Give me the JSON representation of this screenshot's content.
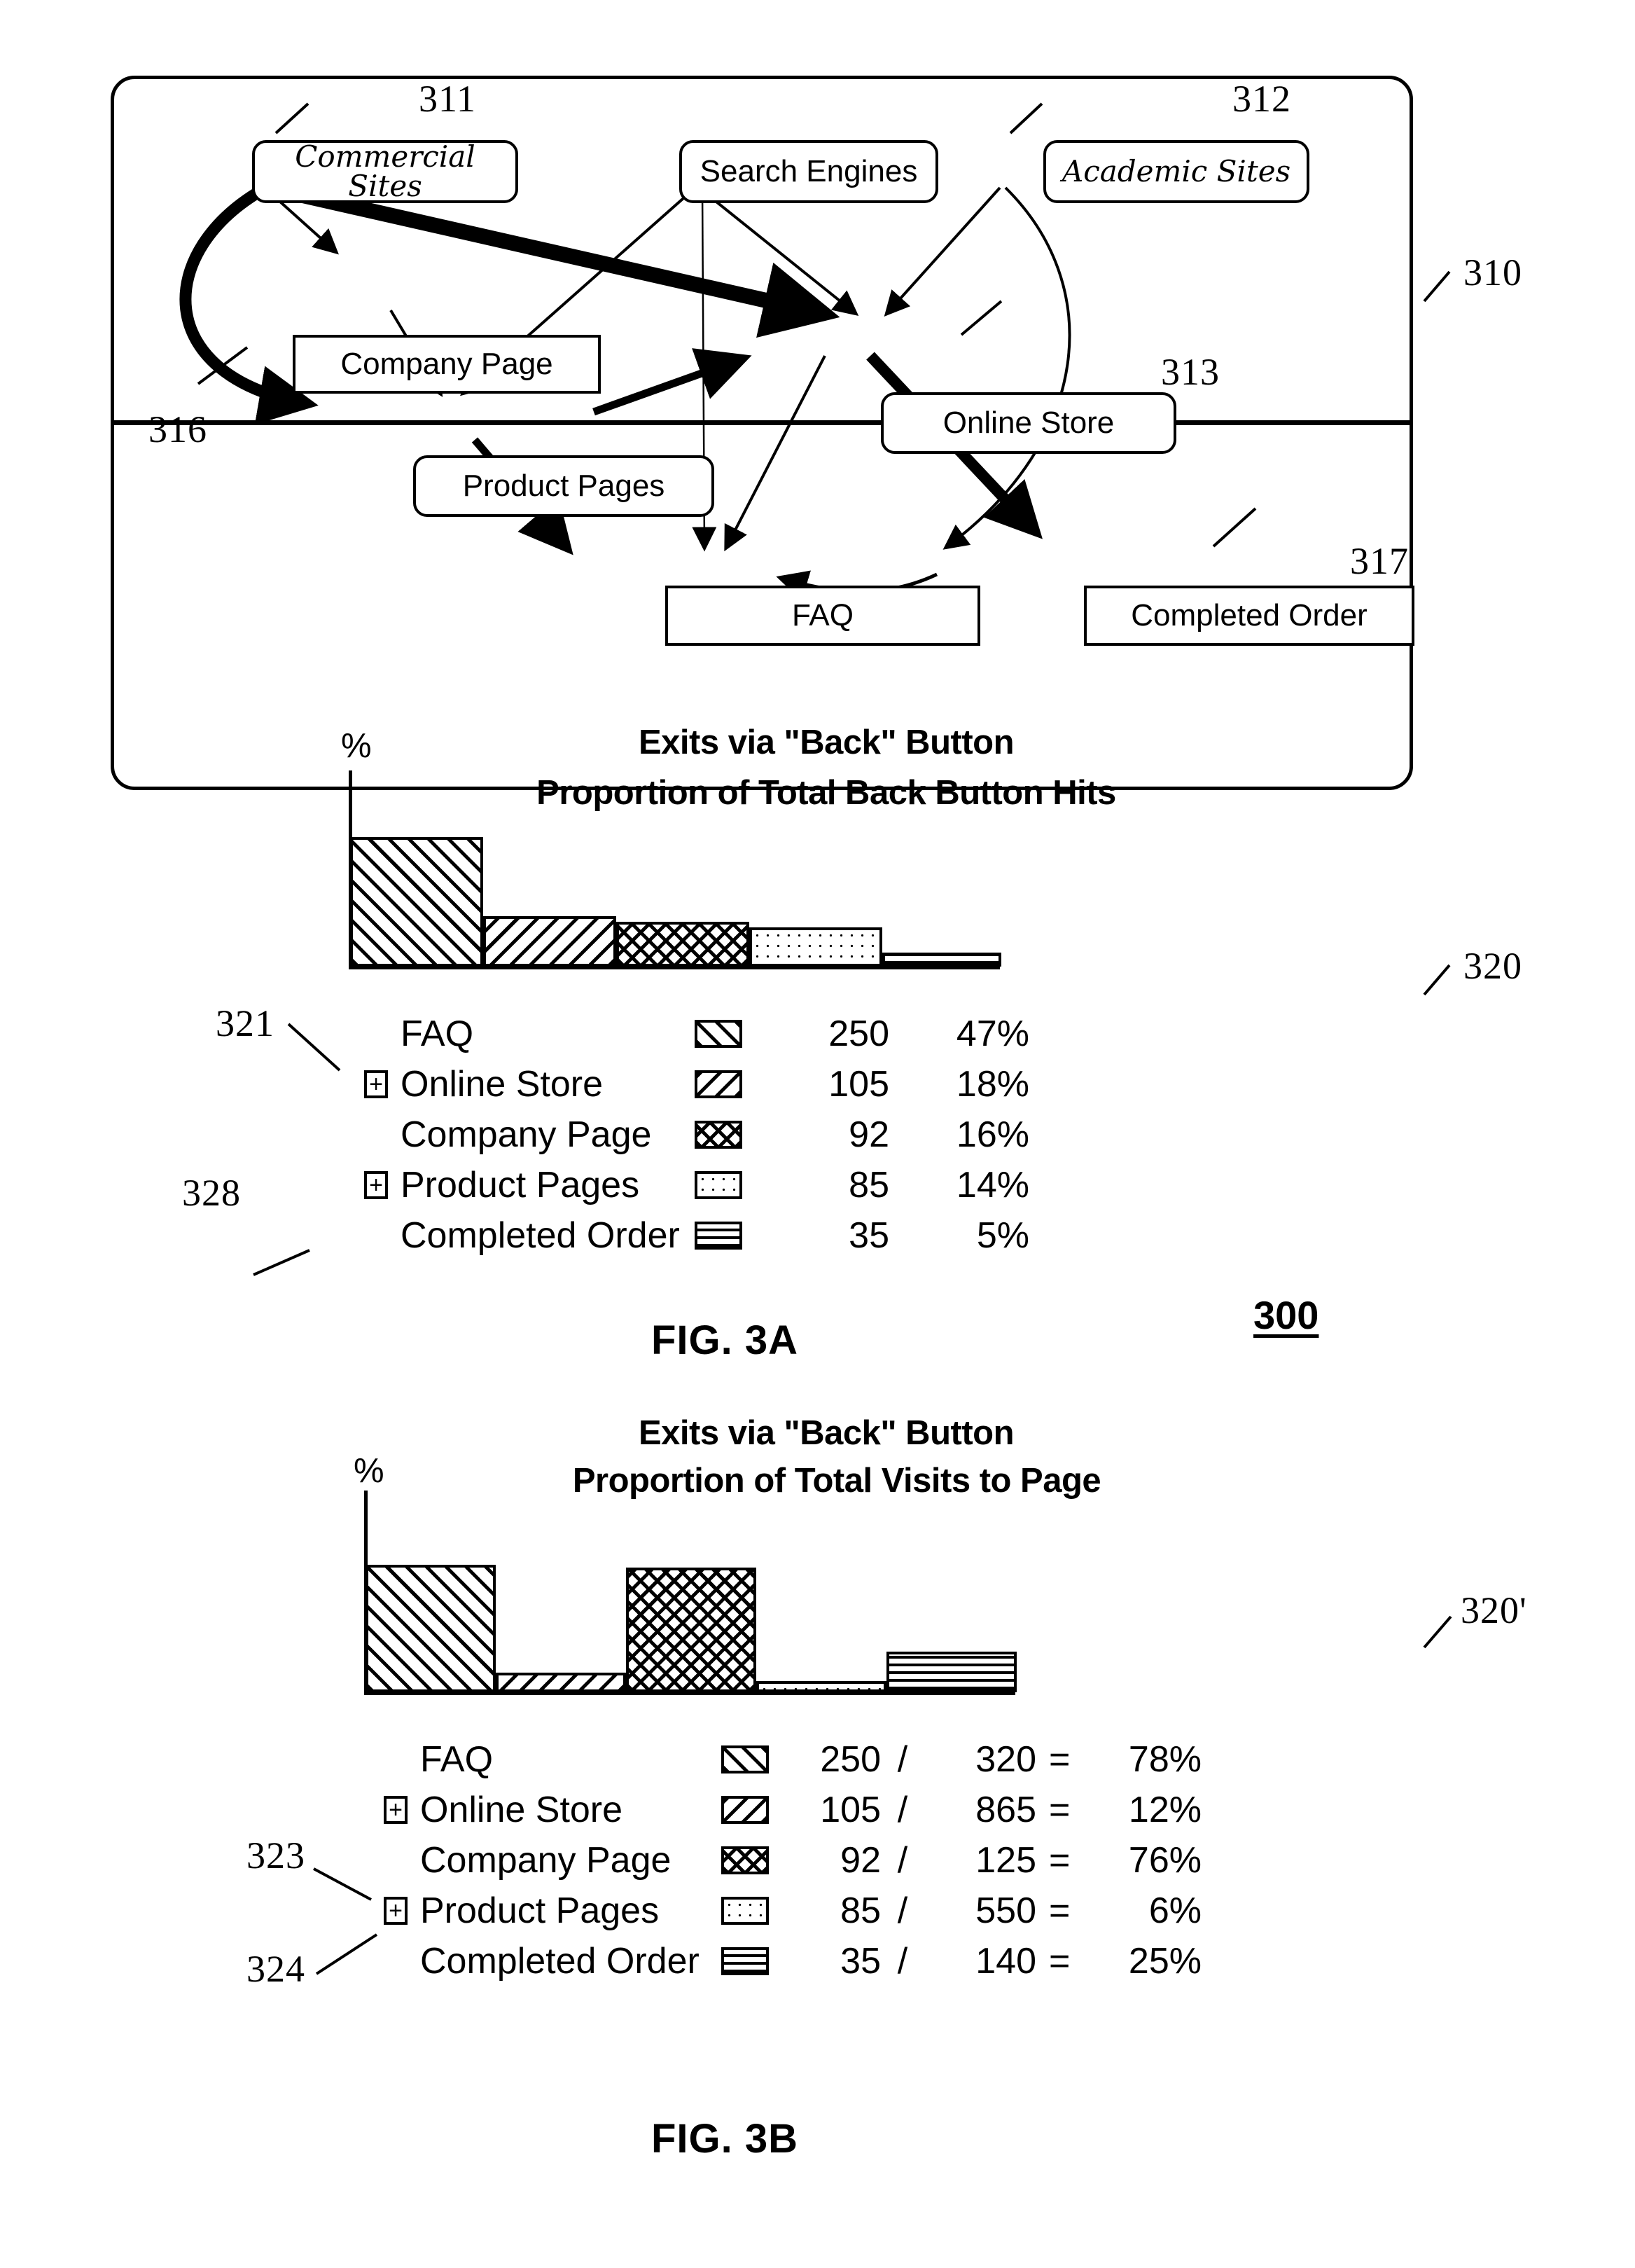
{
  "figure": {
    "fig_a_label": "FIG. 3A",
    "fig_b_label": "FIG. 3B",
    "system_ref": "300"
  },
  "refs": {
    "r310": "310",
    "r311": "311",
    "r312": "312",
    "r313": "313",
    "r316": "316",
    "r317": "317",
    "r320": "320",
    "r320p": "320'",
    "r321": "321",
    "r323": "323",
    "r324": "324",
    "r328": "328"
  },
  "graph": {
    "nodes": [
      {
        "id": "commercial_sites",
        "label": "Commercial Sites",
        "shape": "rounded",
        "style": "script"
      },
      {
        "id": "search_engines",
        "label": "Search Engines",
        "shape": "rounded",
        "style": "plain"
      },
      {
        "id": "academic_sites",
        "label": "Academic Sites",
        "shape": "rounded",
        "style": "script"
      },
      {
        "id": "company_page",
        "label": "Company Page",
        "shape": "rect",
        "style": "plain"
      },
      {
        "id": "online_store",
        "label": "Online Store",
        "shape": "rounded",
        "style": "plain"
      },
      {
        "id": "product_pages",
        "label": "Product Pages",
        "shape": "rounded",
        "style": "plain"
      },
      {
        "id": "faq",
        "label": "FAQ",
        "shape": "rect",
        "style": "plain"
      },
      {
        "id": "completed_order",
        "label": "Completed Order",
        "shape": "rect",
        "style": "plain"
      }
    ],
    "edges": [
      {
        "from": "commercial_sites",
        "to": "company_page",
        "weight": "thin"
      },
      {
        "from": "commercial_sites",
        "to": "online_store",
        "weight": "thick"
      },
      {
        "from": "commercial_sites",
        "to": "product_pages",
        "weight": "thick-curve"
      },
      {
        "from": "search_engines",
        "to": "product_pages",
        "weight": "thin"
      },
      {
        "from": "search_engines",
        "to": "online_store",
        "weight": "thin"
      },
      {
        "from": "search_engines",
        "to": "faq",
        "weight": "hairline"
      },
      {
        "from": "academic_sites",
        "to": "online_store",
        "weight": "thin"
      },
      {
        "from": "academic_sites",
        "to": "completed_order",
        "weight": "thin-curve"
      },
      {
        "from": "company_page",
        "to": "product_pages",
        "weight": "thin"
      },
      {
        "from": "product_pages",
        "to": "online_store",
        "weight": "medium"
      },
      {
        "from": "product_pages",
        "to": "faq",
        "weight": "medium"
      },
      {
        "from": "online_store",
        "to": "completed_order",
        "weight": "thick"
      },
      {
        "from": "online_store",
        "to": "faq",
        "weight": "thin"
      },
      {
        "from": "completed_order",
        "to": "faq",
        "weight": "thin-curve"
      }
    ]
  },
  "chart_data": [
    {
      "id": "chart_3a",
      "type": "bar",
      "title": "Exits via \"Back\" Button",
      "subtitle": "Proportion of Total Back Button Hits",
      "ylabel": "%",
      "xlabel": "",
      "grid": false,
      "legend_position": "below",
      "categories": [
        "FAQ",
        "Online Store",
        "Company Page",
        "Product Pages",
        "Completed Order"
      ],
      "values": [
        47,
        18,
        16,
        14,
        5
      ],
      "counts": [
        250,
        105,
        92,
        85,
        35
      ],
      "value_labels": [
        "47%",
        "18%",
        "16%",
        "14%",
        "5%"
      ],
      "count_labels": [
        "250",
        "105",
        "92",
        "85",
        "35"
      ],
      "patterns": [
        "forward-diagonal",
        "backward-diagonal",
        "crosshatch",
        "dotted",
        "horizontal"
      ],
      "expandable": [
        false,
        true,
        false,
        true,
        false
      ],
      "ylim": [
        0,
        50
      ]
    },
    {
      "id": "chart_3b",
      "type": "bar",
      "title": "Exits via \"Back\" Button",
      "subtitle": "Proportion of Total Visits to Page",
      "ylabel": "%",
      "xlabel": "",
      "grid": false,
      "legend_position": "below",
      "categories": [
        "FAQ",
        "Online Store",
        "Company Page",
        "Product Pages",
        "Completed Order"
      ],
      "values": [
        78,
        12,
        76,
        6,
        25
      ],
      "numerators": [
        250,
        105,
        92,
        85,
        35
      ],
      "denominators": [
        320,
        865,
        125,
        550,
        140
      ],
      "numerator_labels": [
        "250",
        "105",
        "92",
        "85",
        "35"
      ],
      "denominator_labels": [
        "320",
        "865",
        "125",
        "550",
        "140"
      ],
      "value_labels": [
        "78%",
        "12%",
        "76%",
        "6%",
        "25%"
      ],
      "patterns": [
        "forward-diagonal",
        "backward-diagonal",
        "crosshatch",
        "dotted",
        "horizontal"
      ],
      "expandable": [
        false,
        true,
        false,
        true,
        false
      ],
      "ylim": [
        0,
        100
      ]
    }
  ],
  "legend_a": {
    "rows": [
      {
        "label": "FAQ",
        "expand": "",
        "count": "250",
        "percent": "47%"
      },
      {
        "label": "Online Store",
        "expand": "+",
        "count": "105",
        "percent": "18%"
      },
      {
        "label": "Company Page",
        "expand": "",
        "count": "92",
        "percent": "16%"
      },
      {
        "label": "Product Pages",
        "expand": "+",
        "count": "85",
        "percent": "14%"
      },
      {
        "label": "Completed Order",
        "expand": "",
        "count": "35",
        "percent": "5%"
      }
    ]
  },
  "legend_b": {
    "divider": "/",
    "equals": "=",
    "rows": [
      {
        "label": "FAQ",
        "expand": "",
        "num": "250",
        "den": "320",
        "percent": "78%"
      },
      {
        "label": "Online Store",
        "expand": "+",
        "num": "105",
        "den": "865",
        "percent": "12%"
      },
      {
        "label": "Company Page",
        "expand": "",
        "num": "92",
        "den": "125",
        "percent": "76%"
      },
      {
        "label": "Product Pages",
        "expand": "+",
        "num": "85",
        "den": "550",
        "percent": "6%"
      },
      {
        "label": "Completed Order",
        "expand": "",
        "num": "35",
        "den": "140",
        "percent": "25%"
      }
    ]
  }
}
